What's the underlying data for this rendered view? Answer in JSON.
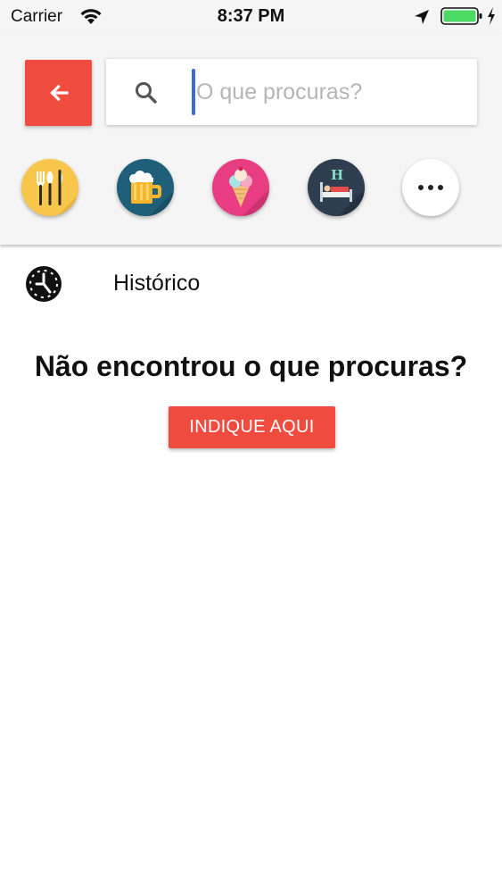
{
  "status_bar": {
    "carrier": "Carrier",
    "time": "8:37 PM",
    "battery_color": "#4cd964"
  },
  "header": {
    "back_icon": "arrow-left-icon",
    "accent_color": "#f04b3f",
    "search": {
      "icon": "search-icon",
      "placeholder": "O que procuras?",
      "value": ""
    },
    "categories": [
      {
        "icon": "utensils-icon",
        "color": "#f7c64a"
      },
      {
        "icon": "beer-mug-icon",
        "color": "#1f5f7a"
      },
      {
        "icon": "ice-cream-icon",
        "color": "#e83d83"
      },
      {
        "icon": "hotel-bed-icon",
        "color": "#2e3d50"
      },
      {
        "icon": "more-dots-icon",
        "color": "#ffffff"
      }
    ]
  },
  "history": {
    "icon": "clock-icon",
    "label": "Histórico"
  },
  "not_found": {
    "title": "Não encontrou o que procuras?",
    "button_label": "INDIQUE AQUI"
  }
}
